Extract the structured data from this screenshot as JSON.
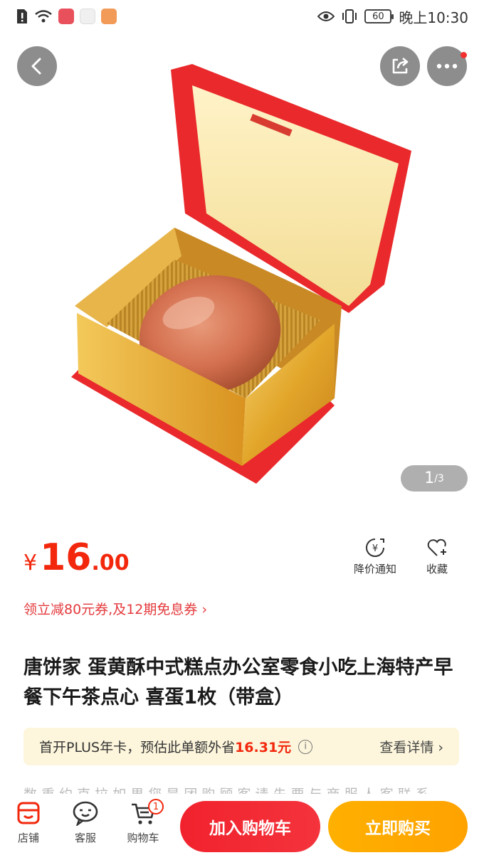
{
  "status_bar": {
    "time": "晚上10:30",
    "battery": "60"
  },
  "gallery": {
    "current": "1",
    "total": "/3"
  },
  "price": {
    "symbol": "¥",
    "integer": "16",
    "decimal": ".00"
  },
  "actions": {
    "notify_label": "降价通知",
    "favorite_label": "收藏"
  },
  "coupon": {
    "text": "领立减80元券,及12期免息券",
    "arrow": "›"
  },
  "product": {
    "title": "唐饼家 蛋黄酥中式糕点办公室零食小吃上海特产早餐下午茶点心 喜蛋1枚（带盒）"
  },
  "plus": {
    "prefix": "首开PLUS年卡，预估此单额外省",
    "amount": "16.31元",
    "info": "i",
    "detail": "查看详情 ›"
  },
  "partial_text": "数 重 约 克 拉   如 果 您 是 团 购 顾 客   请   先 要 与 商 服 人 客 联 系",
  "bottom_bar": {
    "store_label": "店铺",
    "service_label": "客服",
    "cart_label": "购物车",
    "cart_count": "1",
    "add_to_cart": "加入购物车",
    "buy_now": "立即购买"
  },
  "colors": {
    "accent_red": "#f2270c",
    "buy_orange": "#ffa800",
    "plus_bg": "#fdf6dc"
  }
}
